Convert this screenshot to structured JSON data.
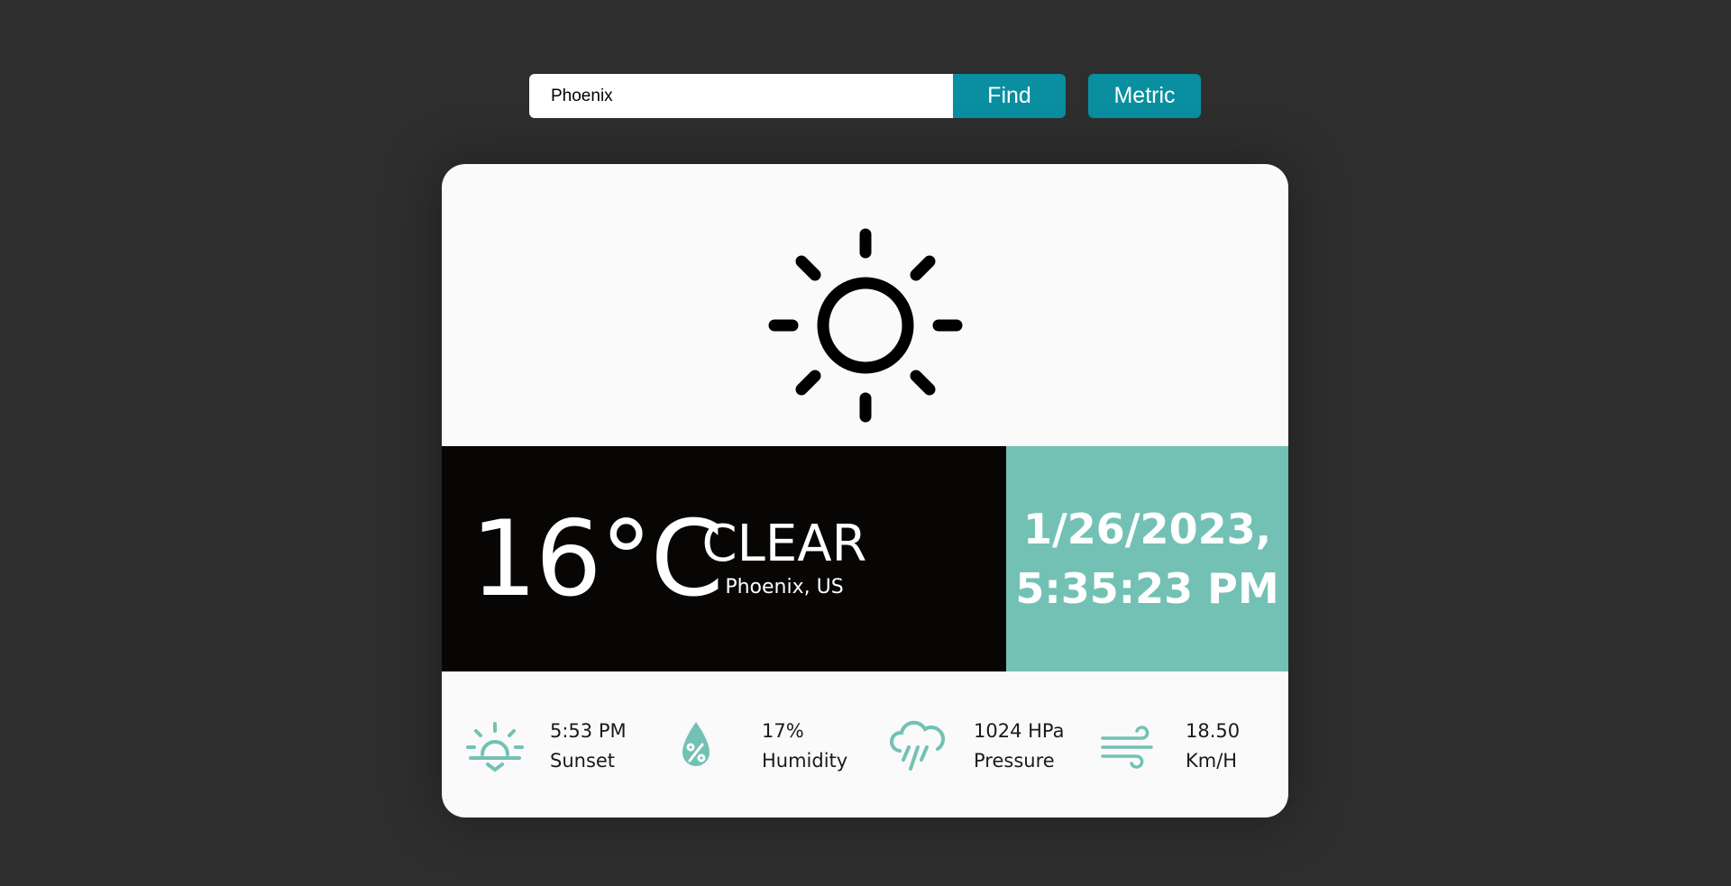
{
  "search": {
    "value": "Phoenix",
    "find_label": "Find",
    "unit_label": "Metric"
  },
  "weather": {
    "icon": "sun-icon",
    "temperature": "16°C",
    "condition": "CLEAR",
    "location": "Phoenix, US",
    "date": "1/26/2023,",
    "time": "5:35:23 PM"
  },
  "stats": [
    {
      "icon": "sunset-icon",
      "value": "5:53 PM",
      "label": "Sunset"
    },
    {
      "icon": "humidity-icon",
      "value": "17%",
      "label": "Humidity"
    },
    {
      "icon": "rain-cloud-icon",
      "value": "1024 HPa",
      "label": "Pressure"
    },
    {
      "icon": "wind-icon",
      "value": "18.50",
      "label": "Km/H"
    }
  ],
  "colors": {
    "background": "#2e2e2e",
    "accent_button": "#0a8fa0",
    "teal_panel": "#73c1b5",
    "black_panel": "#070605",
    "card": "#fafafa",
    "stat_icon": "#73c1b5"
  }
}
